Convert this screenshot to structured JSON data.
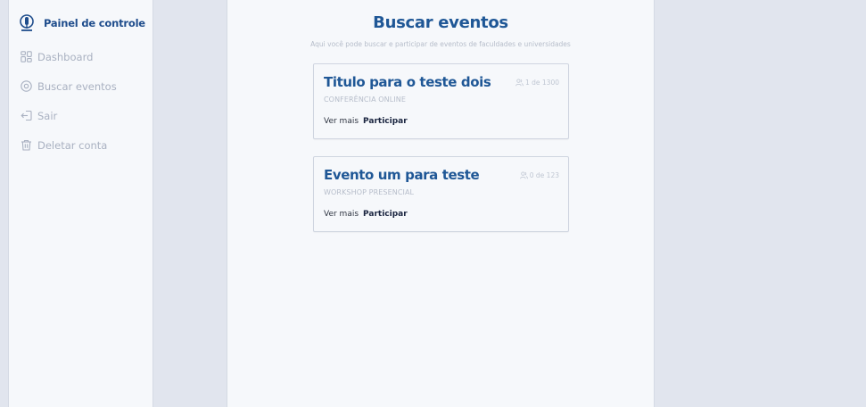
{
  "sidebar": {
    "brand_title": "Painel de controle",
    "items": [
      {
        "label": "Dashboard",
        "icon": "dashboard-grid-icon"
      },
      {
        "label": "Buscar eventos",
        "icon": "location-pin-icon"
      },
      {
        "label": "Sair",
        "icon": "logout-icon"
      },
      {
        "label": "Deletar conta",
        "icon": "trash-icon"
      }
    ]
  },
  "main": {
    "title": "Buscar eventos",
    "subtitle": "Aqui você pode buscar e participar de eventos de faculdades e universidades",
    "events": [
      {
        "title": "Titulo para o teste dois",
        "count": "1 de 1300",
        "type": "CONFERÊNCIA ONLINE",
        "more_label": "Ver mais",
        "join_label": "Participar"
      },
      {
        "title": "Evento um para teste",
        "count": "0 de 123",
        "type": "WORKSHOP PRESENCIAL",
        "more_label": "Ver mais",
        "join_label": "Participar"
      }
    ]
  },
  "colors": {
    "brand": "#1f4d8c",
    "title": "#1f5796",
    "muted": "#a9b1c1",
    "background": "#e1e5ee",
    "panel": "#f6f8fb"
  }
}
